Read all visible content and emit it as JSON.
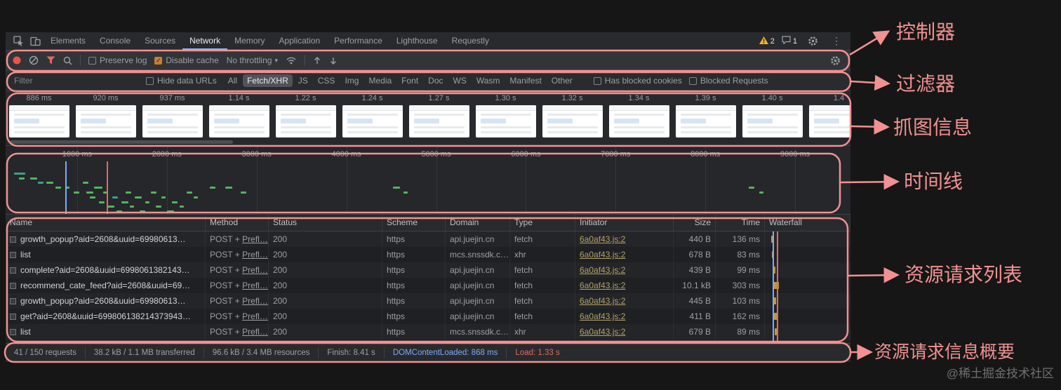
{
  "colors": {
    "annotation_pink": "#f19191",
    "accent_blue": "#8ab4f8",
    "dcl_blue": "#7cacf8",
    "load_red": "#e46962",
    "mark_green": "#54b45e",
    "mark_teal": "#3aa08c",
    "checked_orange": "#c87e2d",
    "waterfall_yellow": "#bd9a45"
  },
  "tabbar": {
    "tabs": [
      "Elements",
      "Console",
      "Sources",
      "Network",
      "Memory",
      "Application",
      "Performance",
      "Lighthouse",
      "Requestly"
    ],
    "selected": "Network",
    "warning_count": "2",
    "message_count": "1"
  },
  "toolbar": {
    "preserve_log": "Preserve log",
    "disable_cache": "Disable cache",
    "throttling": "No throttling"
  },
  "filterbar": {
    "placeholder": "Filter",
    "hide_data_urls": "Hide data URLs",
    "chips": [
      "All",
      "Fetch/XHR",
      "JS",
      "CSS",
      "Img",
      "Media",
      "Font",
      "Doc",
      "WS",
      "Wasm",
      "Manifest",
      "Other"
    ],
    "selected_chip": "Fetch/XHR",
    "has_blocked_cookies": "Has blocked cookies",
    "blocked_requests": "Blocked Requests"
  },
  "filmstrip": {
    "frames": [
      "886 ms",
      "920 ms",
      "937 ms",
      "1.14 s",
      "1.22 s",
      "1.24 s",
      "1.27 s",
      "1.30 s",
      "1.32 s",
      "1.34 s",
      "1.39 s",
      "1.40 s",
      "1.4"
    ]
  },
  "timeline": {
    "tick_ms": [
      1000,
      2000,
      3000,
      4000,
      5000,
      6000,
      7000,
      8000,
      9000
    ],
    "tick_labels": [
      "1000 ms",
      "2000 ms",
      "3000 ms",
      "4000 ms",
      "5000 ms",
      "6000 ms",
      "7000 ms",
      "8000 ms",
      "9000 ms"
    ],
    "dcl_ms": 868,
    "load_ms": 1330,
    "marks": [
      [
        300,
        1,
        16,
        "t"
      ],
      [
        350,
        2,
        8,
        "g"
      ],
      [
        480,
        2,
        10,
        "g"
      ],
      [
        560,
        3,
        8,
        "t"
      ],
      [
        660,
        3,
        10,
        "g"
      ],
      [
        760,
        4,
        8,
        "g"
      ],
      [
        870,
        4,
        6,
        "g"
      ],
      [
        960,
        5,
        8,
        "g"
      ],
      [
        1060,
        3,
        8,
        "g"
      ],
      [
        1100,
        5,
        10,
        "g"
      ],
      [
        1140,
        6,
        8,
        "g"
      ],
      [
        1190,
        4,
        12,
        "g"
      ],
      [
        1240,
        7,
        8,
        "g"
      ],
      [
        1290,
        5,
        6,
        "g"
      ],
      [
        1340,
        8,
        10,
        "g"
      ],
      [
        1390,
        6,
        8,
        "t"
      ],
      [
        1440,
        9,
        8,
        "g"
      ],
      [
        1490,
        7,
        10,
        "g"
      ],
      [
        1540,
        5,
        8,
        "g"
      ],
      [
        1590,
        8,
        6,
        "g"
      ],
      [
        1640,
        6,
        10,
        "g"
      ],
      [
        1700,
        9,
        8,
        "g"
      ],
      [
        1760,
        7,
        6,
        "g"
      ],
      [
        1820,
        5,
        8,
        "g"
      ],
      [
        1880,
        8,
        8,
        "g"
      ],
      [
        1940,
        6,
        6,
        "g"
      ],
      [
        2000,
        9,
        10,
        "g"
      ],
      [
        2060,
        7,
        8,
        "g"
      ],
      [
        2140,
        8,
        6,
        "g"
      ],
      [
        2220,
        5,
        8,
        "g"
      ],
      [
        2300,
        6,
        6,
        "g"
      ],
      [
        2480,
        4,
        8,
        "g"
      ],
      [
        2650,
        4,
        10,
        "g"
      ],
      [
        2820,
        5,
        8,
        "g"
      ],
      [
        4520,
        4,
        10,
        "g"
      ],
      [
        4640,
        5,
        6,
        "g"
      ],
      [
        8480,
        4,
        8,
        "g"
      ],
      [
        8600,
        5,
        6,
        "g"
      ]
    ]
  },
  "table": {
    "columns": [
      "Name",
      "Method",
      "Status",
      "Scheme",
      "Domain",
      "Type",
      "Initiator",
      "Size",
      "Time",
      "Waterfall"
    ],
    "rows": [
      {
        "name": "growth_popup?aid=2608&uuid=69980613…",
        "method_prefix": "POST + ",
        "method_link": "Prefl…",
        "status": "200",
        "scheme": "https",
        "domain": "api.juejin.cn",
        "type": "fetch",
        "initiator": "6a0af43.js:2",
        "size": "440 B",
        "time": "136 ms",
        "wf": {
          "x": 9,
          "w": 4
        }
      },
      {
        "name": "list",
        "method_prefix": "POST + ",
        "method_link": "Prefl…",
        "status": "200",
        "scheme": "https",
        "domain": "mcs.snssdk.c…",
        "type": "xhr",
        "initiator": "6a0af43.js:2",
        "size": "678 B",
        "time": "83 ms",
        "wf": {
          "x": 10,
          "w": 3
        }
      },
      {
        "name": "complete?aid=2608&uuid=6998061382143…",
        "method_prefix": "POST + ",
        "method_link": "Prefl…",
        "status": "200",
        "scheme": "https",
        "domain": "api.juejin.cn",
        "type": "fetch",
        "initiator": "6a0af43.js:2",
        "size": "439 B",
        "time": "99 ms",
        "wf": {
          "x": 11,
          "w": 4
        }
      },
      {
        "name": "recommend_cate_feed?aid=2608&uuid=69…",
        "method_prefix": "POST + ",
        "method_link": "Prefl…",
        "status": "200",
        "scheme": "https",
        "domain": "api.juejin.cn",
        "type": "fetch",
        "initiator": "6a0af43.js:2",
        "size": "10.1 kB",
        "time": "303 ms",
        "wf": {
          "x": 11,
          "w": 9
        }
      },
      {
        "name": "growth_popup?aid=2608&uuid=69980613…",
        "method_prefix": "POST + ",
        "method_link": "Prefl…",
        "status": "200",
        "scheme": "https",
        "domain": "api.juejin.cn",
        "type": "fetch",
        "initiator": "6a0af43.js:2",
        "size": "445 B",
        "time": "103 ms",
        "wf": {
          "x": 12,
          "w": 4
        }
      },
      {
        "name": "get?aid=2608&uuid=699806138214373943…",
        "method_prefix": "POST + ",
        "method_link": "Prefl…",
        "status": "200",
        "scheme": "https",
        "domain": "api.juejin.cn",
        "type": "fetch",
        "initiator": "6a0af43.js:2",
        "size": "411 B",
        "time": "162 ms",
        "wf": {
          "x": 13,
          "w": 5
        }
      },
      {
        "name": "list",
        "method_prefix": "POST + ",
        "method_link": "Prefl…",
        "status": "200",
        "scheme": "https",
        "domain": "mcs.snssdk.c…",
        "type": "xhr",
        "initiator": "6a0af43.js:2",
        "size": "679 B",
        "time": "89 ms",
        "wf": {
          "x": 14,
          "w": 3
        }
      }
    ]
  },
  "statusbar": {
    "items": [
      "41 / 150 requests",
      "38.2 kB / 1.1 MB transferred",
      "96.6 kB / 3.4 MB resources",
      "Finish: 8.41 s"
    ],
    "dom_content_loaded": "DOMContentLoaded: 868 ms",
    "load": "Load: 1.33 s"
  },
  "annotations": {
    "controller": "控制器",
    "filter": "过滤器",
    "capture": "抓图信息",
    "timeline": "时间线",
    "request_list": "资源请求列表",
    "summary": "资源请求信息概要"
  },
  "watermark": "@稀土掘金技术社区"
}
